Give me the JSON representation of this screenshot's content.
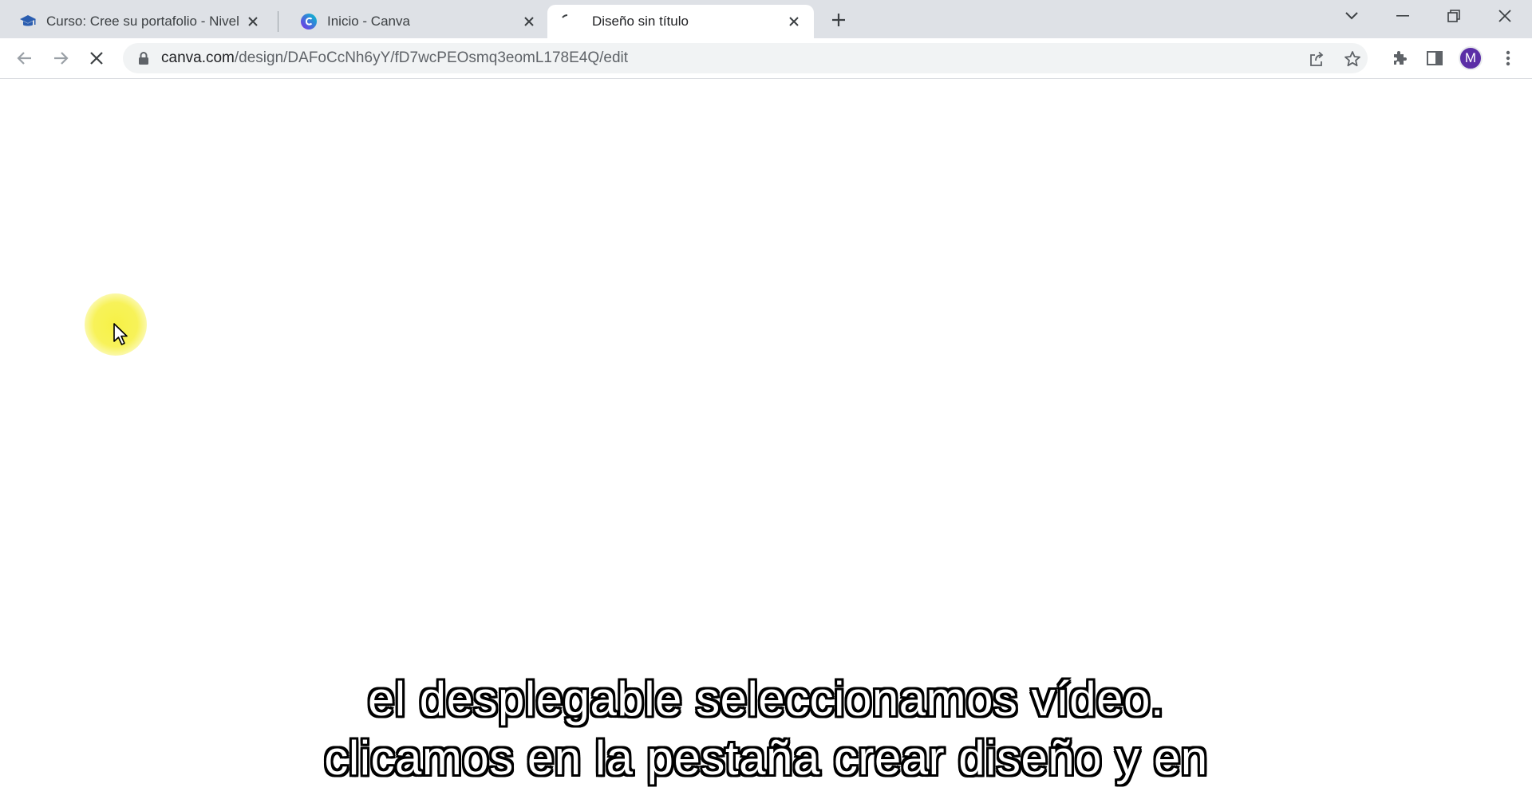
{
  "browser": {
    "tabs": [
      {
        "title": "Curso: Cree su portafolio - Nivel",
        "favicon": "graduation-cap-icon",
        "active": false
      },
      {
        "title": "Inicio - Canva",
        "favicon": "canva-logo-icon",
        "active": false
      },
      {
        "title": "Diseño sin título",
        "favicon": "loading-spinner-icon",
        "active": true
      }
    ],
    "address_bar": {
      "domain": "canva.com",
      "path": "/design/DAFoCcNh6yY/fD7wcPEOsmq3eomL178E4Q/edit"
    },
    "profile_initial": "M"
  },
  "subtitles": {
    "line1": "el desplegable seleccionamos vídeo.",
    "line2": "clicamos en la pestaña crear diseño y en"
  },
  "colors": {
    "tabstrip": "#dee1e6",
    "omnibox": "#f1f3f4",
    "avatar": "#5b2ea6",
    "cursor_highlight": "#f6f03c"
  }
}
